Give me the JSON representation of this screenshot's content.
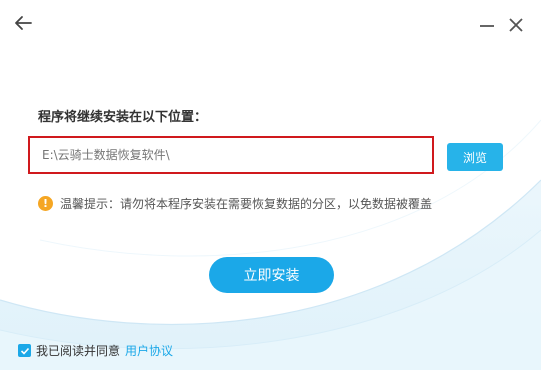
{
  "header": {
    "back_icon": "arrow-left-icon",
    "minimize_icon": "minimize-icon",
    "close_icon": "close-icon"
  },
  "install": {
    "location_label": "程序将继续安装在以下位置：",
    "path_placeholder": "E:\\云骑士数据恢复软件\\",
    "browse_label": "浏览",
    "tip_icon": "info-icon",
    "tip_text": "温馨提示：请勿将本程序安装在需要恢复数据的分区，以免数据被覆盖",
    "install_label": "立即安装"
  },
  "footer": {
    "agree_checked": true,
    "agree_text": "我已阅读并同意",
    "agreement_link": "用户协议"
  },
  "colors": {
    "accent": "#1ba8e8",
    "highlight_border": "#d0191d",
    "warning": "#f5a623"
  }
}
